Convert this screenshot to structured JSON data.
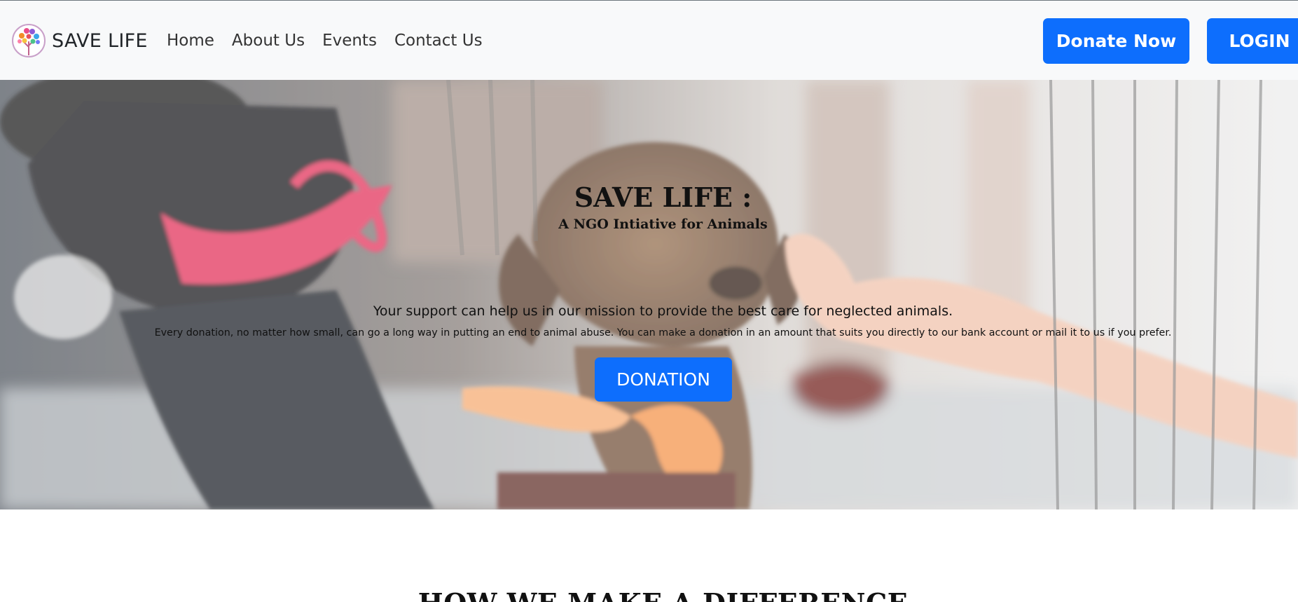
{
  "navbar": {
    "brand": "SAVE LIFE",
    "links": [
      "Home",
      "About Us",
      "Events",
      "Contact Us"
    ],
    "donate_button": "Donate Now",
    "login_button": "LOGIN"
  },
  "hero": {
    "title": "SAVE LIFE :",
    "subtitle": "A NGO Intiative for Animals",
    "lead": "Your support can help us in our mission to provide the best care for neglected animals.",
    "text": "Every donation, no matter how small, can go a long way in putting an end to animal abuse. You can make a donation in an amount that suits you directly to our bank account or mail it to us if you prefer.",
    "button": "DONATION"
  },
  "section": {
    "heading": "HOW WE MAKE A DIFFERENCE"
  },
  "colors": {
    "primary": "#0d6efd",
    "navbar_bg": "#f8f9fa"
  },
  "icons": {
    "logo": "tree-logo-icon"
  }
}
